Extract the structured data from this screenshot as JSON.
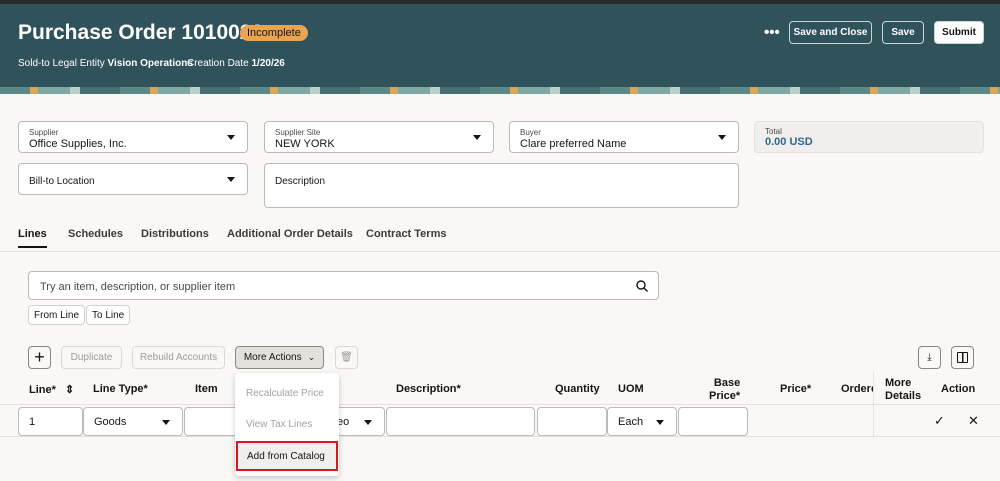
{
  "header": {
    "title": "Purchase Order 1010022",
    "status": "Incomplete",
    "sold_to_label": "Sold-to Legal Entity",
    "sold_to_value": "Vision Operations",
    "creation_label": "Creation Date",
    "creation_value": "1/20/26",
    "more": "•••",
    "save_close": "Save and Close",
    "save": "Save",
    "submit": "Submit"
  },
  "form": {
    "supplier_label": "Supplier",
    "supplier_value": "Office Supplies, Inc.",
    "site_label": "Supplier Site",
    "site_value": "NEW YORK",
    "buyer_label": "Buyer",
    "buyer_value": "Clare preferred Name",
    "total_label": "Total",
    "total_value": "0.00 USD",
    "bill_to_label": "Bill-to Location",
    "description_label": "Description"
  },
  "tabs": [
    "Lines",
    "Schedules",
    "Distributions",
    "Additional Order Details",
    "Contract Terms"
  ],
  "search": {
    "placeholder": "Try an item, description, or supplier item",
    "from_line": "From Line",
    "to_line": "To Line"
  },
  "toolbar": {
    "duplicate": "Duplicate",
    "rebuild": "Rebuild Accounts",
    "more_actions": "More Actions"
  },
  "columns": {
    "line": "Line*",
    "line_type": "Line Type*",
    "item": "Item",
    "description": "Description*",
    "quantity": "Quantity",
    "uom": "UOM",
    "base_price_1": "Base",
    "base_price_2": "Price*",
    "price": "Price*",
    "ordered": "Ordere",
    "more_details_1": "More",
    "more_details_2": "Details",
    "action": "Action"
  },
  "row": {
    "line": "1",
    "line_type": "Goods",
    "category": "eo",
    "uom": "Each"
  },
  "menu": {
    "items": [
      "Recalculate Price",
      "View Tax Lines",
      "Add from Catalog"
    ]
  }
}
